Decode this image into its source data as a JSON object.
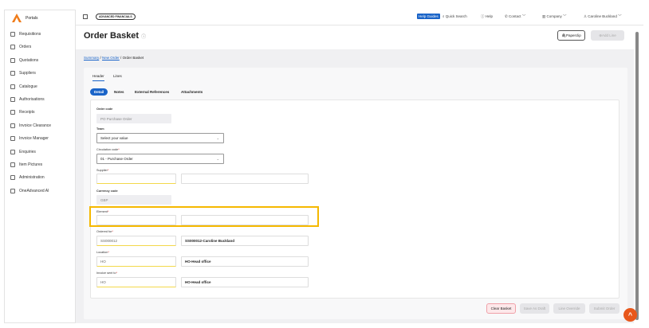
{
  "sidebar": {
    "title": "Portals",
    "items": [
      "Requisitions",
      "Orders",
      "Quotations",
      "Suppliers",
      "Catalogue",
      "Authorisations",
      "Receipts",
      "Invoice Clearance",
      "Invoice Manager",
      "Enquiries",
      "Item Pictures",
      "Administration",
      "OneAdvanced AI"
    ]
  },
  "topbar": {
    "brand": "ADVANCED FINANCIALS",
    "help_guides": "Help Guides",
    "quick_search": "Quick Search",
    "help": "Help",
    "contact": "Contact",
    "company": "Company",
    "user": "Caroline Buckland"
  },
  "page": {
    "title": "Order Basket",
    "paperclip": "Paperclip",
    "add_line": "Add Line"
  },
  "breadcrumb": {
    "summary": "Summary",
    "new_order": "New Order",
    "current": "Order Basket"
  },
  "tabs": [
    "Header",
    "Lines"
  ],
  "subtabs": [
    "Detail",
    "Notes",
    "External References",
    "Attachments"
  ],
  "form": {
    "order_code": {
      "label": "Order code",
      "value": "PO Purchase Order"
    },
    "team": {
      "label": "Team",
      "value": "Select your value"
    },
    "circulation": {
      "label": "Circulation code",
      "value": "01 - Purchase Order"
    },
    "supplier": {
      "label": "Supplier"
    },
    "currency": {
      "label": "Currency code",
      "value": "GBP"
    },
    "element": {
      "label": "Element"
    },
    "ordered_for": {
      "label": "Ordered for",
      "value": "SS000012",
      "desc": "SS000012-Caroline Buckland"
    },
    "location": {
      "label": "Location",
      "value": "HO",
      "desc": "HO-Head office"
    },
    "invoice_to": {
      "label": "Invoice sent to",
      "value": "HO",
      "desc": "HO-Head office"
    }
  },
  "actions": {
    "clear": "Clear Basket",
    "draft": "Save As Draft",
    "override": "Line Override",
    "submit": "Submit Order"
  }
}
